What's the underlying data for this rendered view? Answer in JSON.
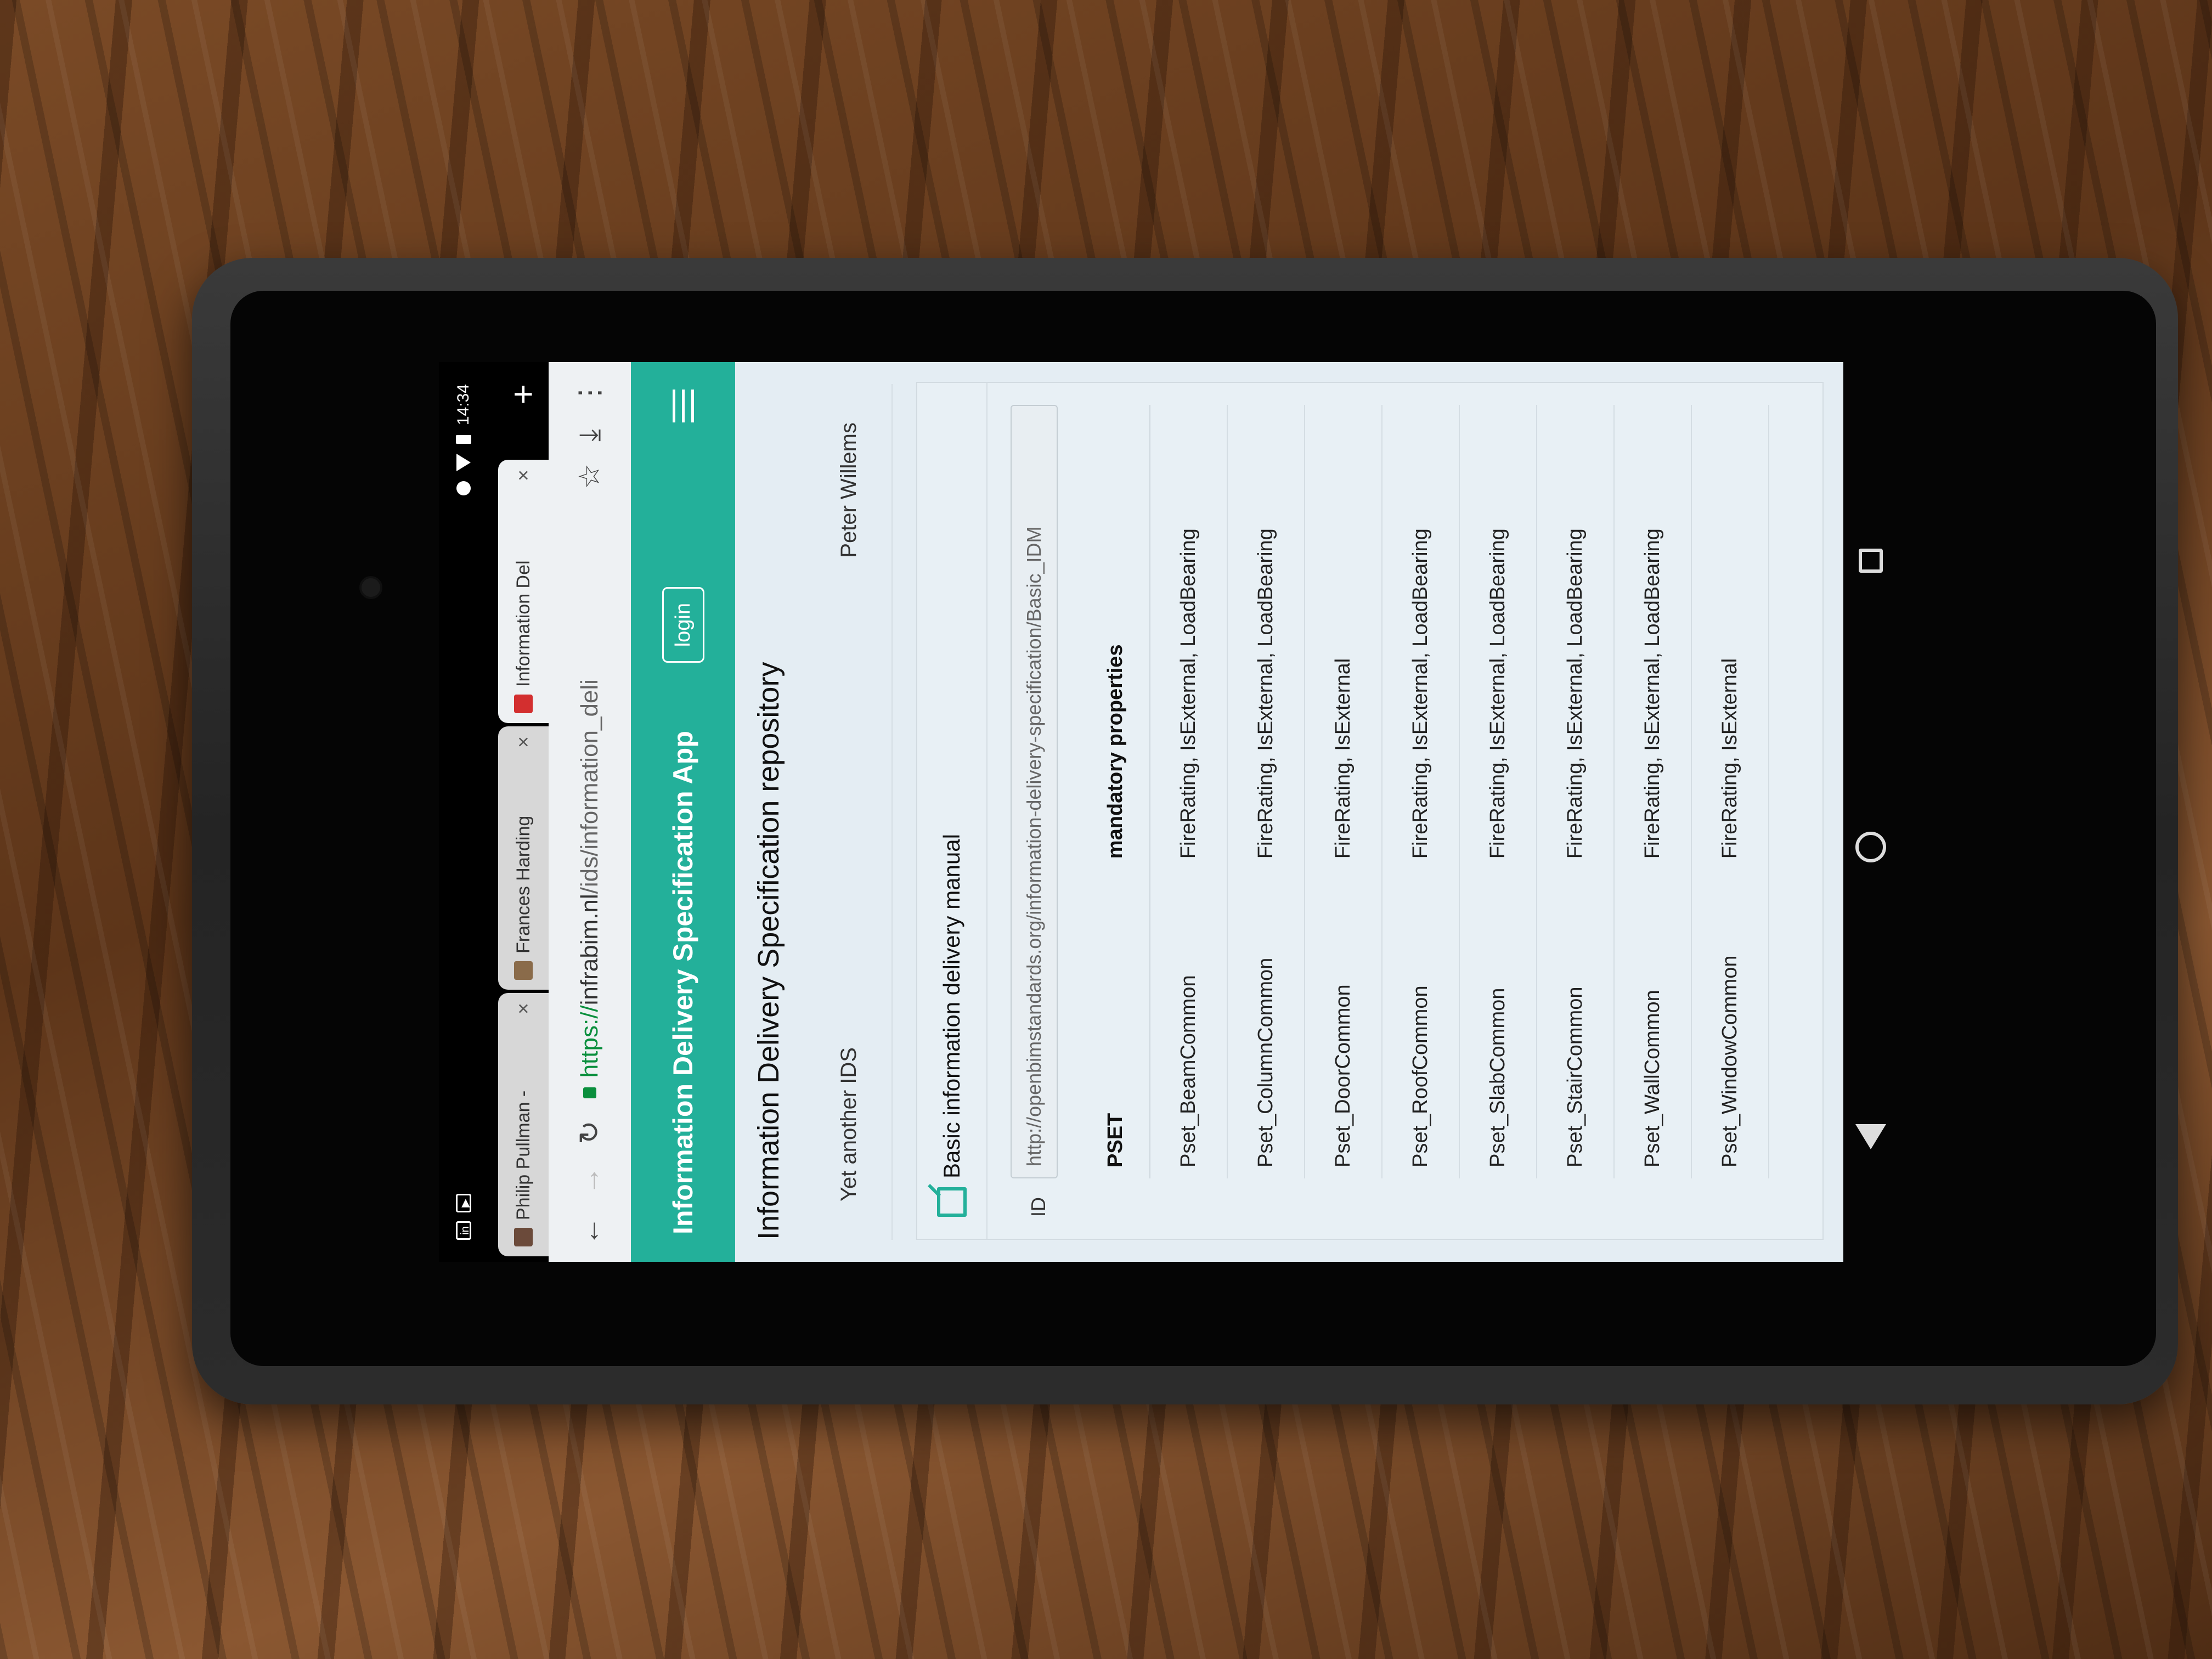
{
  "status_bar": {
    "time": "14:34"
  },
  "tabs": [
    {
      "title": "Philip Pullman -",
      "close": "×"
    },
    {
      "title": "Frances Harding",
      "close": "×"
    },
    {
      "title": "Information Del",
      "close": "×"
    }
  ],
  "new_tab": "+",
  "address": {
    "scheme": "https://",
    "host": "infrabim.nl",
    "path": "/ids/information_deli"
  },
  "app": {
    "title": "Information Delivery Specification App",
    "login_label": "login"
  },
  "page": {
    "heading": "Information Delivery Specification repository",
    "ids_list": [
      {
        "name": "Yet another IDS",
        "author": "Peter Willems"
      }
    ],
    "card": {
      "title": "Basic information delivery manual",
      "id_label": "ID",
      "id_value": "http://openbimstandards.org/information-delivery-specification/Basic_IDM",
      "table": {
        "headers": [
          "PSET",
          "mandatory properties"
        ],
        "rows": [
          [
            "Pset_BeamCommon",
            "FireRating, IsExternal, LoadBearing"
          ],
          [
            "Pset_ColumnCommon",
            "FireRating, IsExternal, LoadBearing"
          ],
          [
            "Pset_DoorCommon",
            "FireRating, IsExternal"
          ],
          [
            "Pset_RoofCommon",
            "FireRating, IsExternal, LoadBearing"
          ],
          [
            "Pset_SlabCommon",
            "FireRating, IsExternal, LoadBearing"
          ],
          [
            "Pset_StairCommon",
            "FireRating, IsExternal, LoadBearing"
          ],
          [
            "Pset_WallCommon",
            "FireRating, IsExternal, LoadBearing"
          ],
          [
            "Pset_WindowCommon",
            "FireRating, IsExternal"
          ]
        ]
      }
    }
  },
  "colors": {
    "accent": "#23b09a",
    "page_bg": "#e4edf3"
  }
}
